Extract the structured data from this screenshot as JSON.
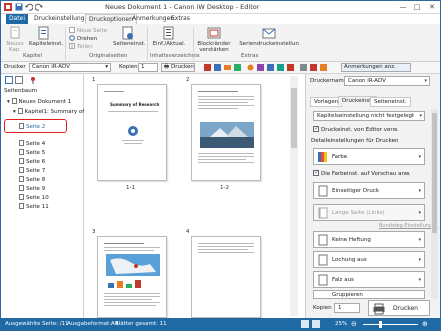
{
  "window": {
    "title": "Neues Dokument 1 - Canon iW Desktop - Editor",
    "controls": {
      "minimize": "—",
      "maximize": "□",
      "close": "✕"
    }
  },
  "ribbon_tabs": [
    "Datei",
    "Druckeinstellungen",
    "Druckoptionen",
    "Anmerkungen",
    "Extras"
  ],
  "ribbon": {
    "groups": {
      "kapitel": "Kapitel",
      "originalseiten": "Originalseiten",
      "inhaltsverzeichnis": "Inhaltsverzeichnis",
      "extras": "Extras"
    },
    "buttons": {
      "neues_kapitel": "Neues Kap.",
      "kapiteleinst": "Kapiteleinst.",
      "neue_seite": "Neue Seite",
      "drehen": "Drehen",
      "teilen": "Teilen",
      "seiteneinst": "Seiteneinst.",
      "einf_aktual": "Einf./Aktual.",
      "blockraender": "Blockränder verstärken",
      "seriendruck": "Seriendruckeinstellun"
    }
  },
  "toolbar": {
    "drucker_label": "Drucker",
    "drucker_value": "Canon iR-ADV",
    "kopien_label": "Kopien",
    "kopien_value": "1",
    "drucken_label": "Drucken",
    "anmerkungen_label": "Anmerkungen anz."
  },
  "left_panel": {
    "title": "Seitenbaum",
    "root": "Neues Dokument 1",
    "chapter": "Kapitel1: Summary of Re",
    "pages": [
      "Seite 2",
      "Seite 4",
      "Seite 5",
      "Seite 6",
      "Seite 7",
      "Seite 8",
      "Seite 9",
      "Seite 10",
      "Seite 11"
    ]
  },
  "document": {
    "pages": [
      {
        "number": "1",
        "label": "1-1",
        "heading": "Summary of Research"
      },
      {
        "number": "2",
        "label": "1-2",
        "heading": ""
      },
      {
        "number": "3",
        "label": "",
        "heading": ""
      },
      {
        "number": "4",
        "label": "",
        "heading": ""
      }
    ]
  },
  "right_panel": {
    "printer_label": "Druckername:",
    "printer_value": "Canon iR-ADV",
    "tabs": [
      "Vorlagen",
      "Druckeinst.",
      "Seiteneinst."
    ],
    "dropdown_top": "Kapitelseinstellung nicht festgelegt",
    "checkbox_editor": "Druckeinst. von Editor verw.",
    "section_label": "Detaileinstellungen für Drucken",
    "color_option": "Farbe",
    "checkbox_color": "Die Farbeinst. auf Vorschau anw.",
    "duplex_option": "Einseitiger Druck",
    "binding_option": "Lange Seite (Links)",
    "binding_link": "Bundsteg-Einstellungen",
    "staple_option": "Keine Heftung",
    "punch_option": "Lochung aus",
    "fold_option": "Falz aus",
    "group_option": "Gruppieren",
    "copies_label": "Kopien",
    "copies_value": "1",
    "print_button": "Drucken"
  },
  "status_bar": {
    "selected": "Ausgewählte Seite: /11",
    "format": "Ausgabeformat:A4",
    "total": "Blätter gesamt: 11",
    "zoom": "25%"
  },
  "colors": {
    "accent": "#1f6aa5",
    "highlight_red": "#e02020",
    "ribbon_bg": "#f3f3f3"
  }
}
